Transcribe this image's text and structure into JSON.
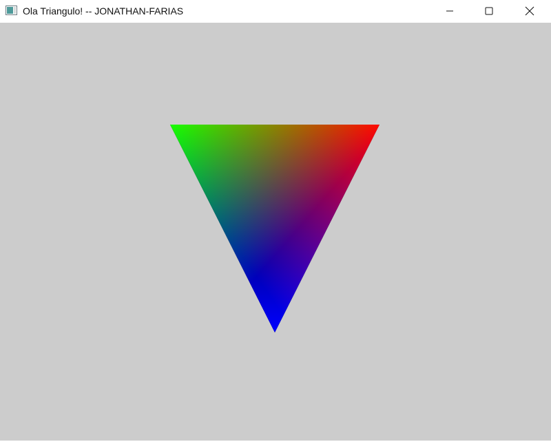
{
  "window": {
    "title": "Ola Triangulo! -- JONATHAN-FARIAS"
  },
  "icons": {
    "app": "window-app-icon",
    "minimize": "minimize-icon",
    "maximize": "maximize-icon",
    "close": "close-icon"
  },
  "client": {
    "background_color": "#cccccc"
  },
  "triangle": {
    "vertex_colors": {
      "top_left": "#00ff00",
      "top_right": "#ff0000",
      "bottom": "#0000ff"
    }
  }
}
